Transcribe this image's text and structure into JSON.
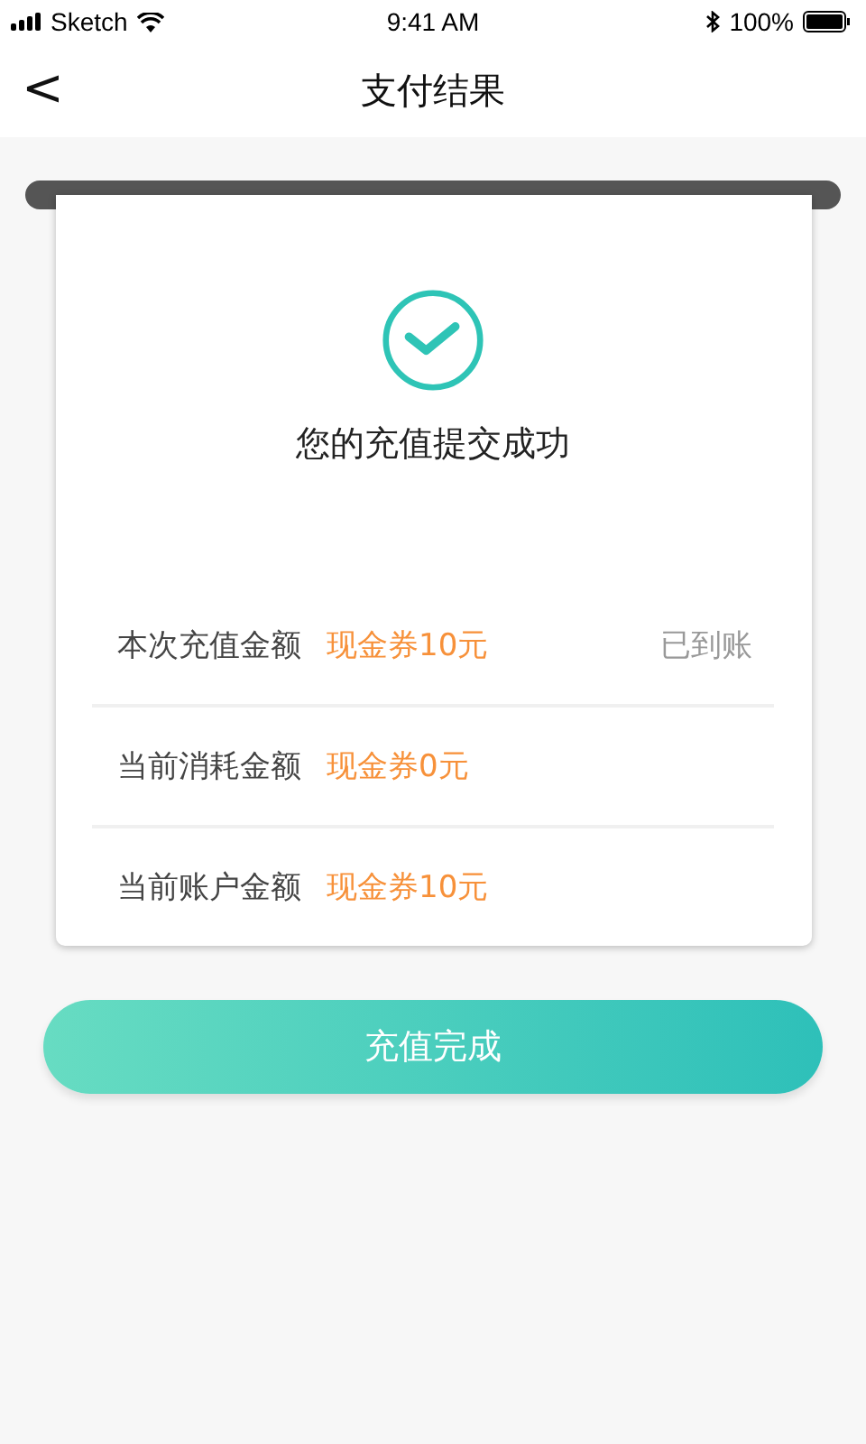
{
  "status_bar": {
    "carrier": "Sketch",
    "time": "9:41 AM",
    "battery": "100%"
  },
  "nav": {
    "back": "<",
    "title": "支付结果"
  },
  "result": {
    "message": "您的充值提交成功"
  },
  "rows": [
    {
      "label": "本次充值金额",
      "value": "现金券10元",
      "status": "已到账"
    },
    {
      "label": "当前消耗金额",
      "value": "现金券0元"
    },
    {
      "label": "当前账户金额",
      "value": "现金券10元"
    }
  ],
  "button": "充值完成"
}
